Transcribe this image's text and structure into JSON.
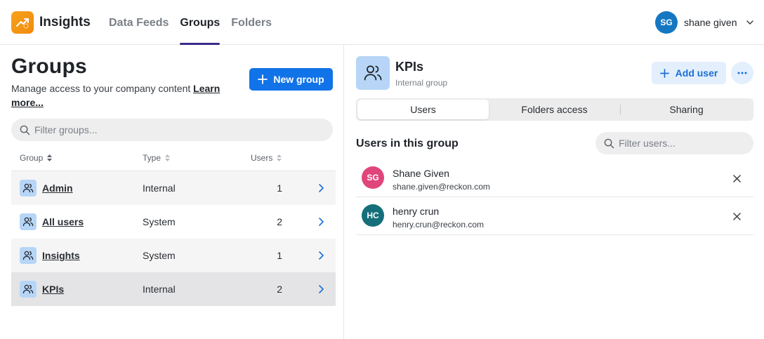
{
  "header": {
    "app_title": "Insights",
    "logo_icon": "trending-up-icon",
    "nav": [
      {
        "label": "Data Feeds",
        "active": false
      },
      {
        "label": "Groups",
        "active": true
      },
      {
        "label": "Folders",
        "active": false
      }
    ],
    "user": {
      "initials": "SG",
      "name": "shane given",
      "avatar_color": "#1577c2"
    }
  },
  "left": {
    "title": "Groups",
    "subtitle": "Manage access to your company content ",
    "learn_more": "Learn more...",
    "new_group_label": "New group",
    "filter_placeholder": "Filter groups...",
    "columns": {
      "group": "Group",
      "type": "Type",
      "users": "Users"
    },
    "groups": [
      {
        "name": "Admin",
        "type": "Internal",
        "users": "1"
      },
      {
        "name": "All users",
        "type": "System",
        "users": "2"
      },
      {
        "name": "Insights",
        "type": "System",
        "users": "1"
      },
      {
        "name": "KPIs",
        "type": "Internal",
        "users": "2"
      }
    ]
  },
  "right": {
    "group_title": "KPIs",
    "group_type": "Internal group",
    "add_user_label": "Add user",
    "tabs": [
      {
        "label": "Users",
        "active": true
      },
      {
        "label": "Folders access",
        "active": false
      },
      {
        "label": "Sharing",
        "active": false
      }
    ],
    "section_title": "Users in this group",
    "filter_placeholder": "Filter users...",
    "users": [
      {
        "initials": "SG",
        "name": "Shane Given",
        "email": "shane.given@reckon.com",
        "color": "#e0457b"
      },
      {
        "initials": "HC",
        "name": "henry crun",
        "email": "henry.crun@reckon.com",
        "color": "#156f7a"
      }
    ]
  },
  "colors": {
    "primary": "#1173e8",
    "accent_tab": "#3d2a8a",
    "group_icon_bg": "#b7d6f7"
  }
}
